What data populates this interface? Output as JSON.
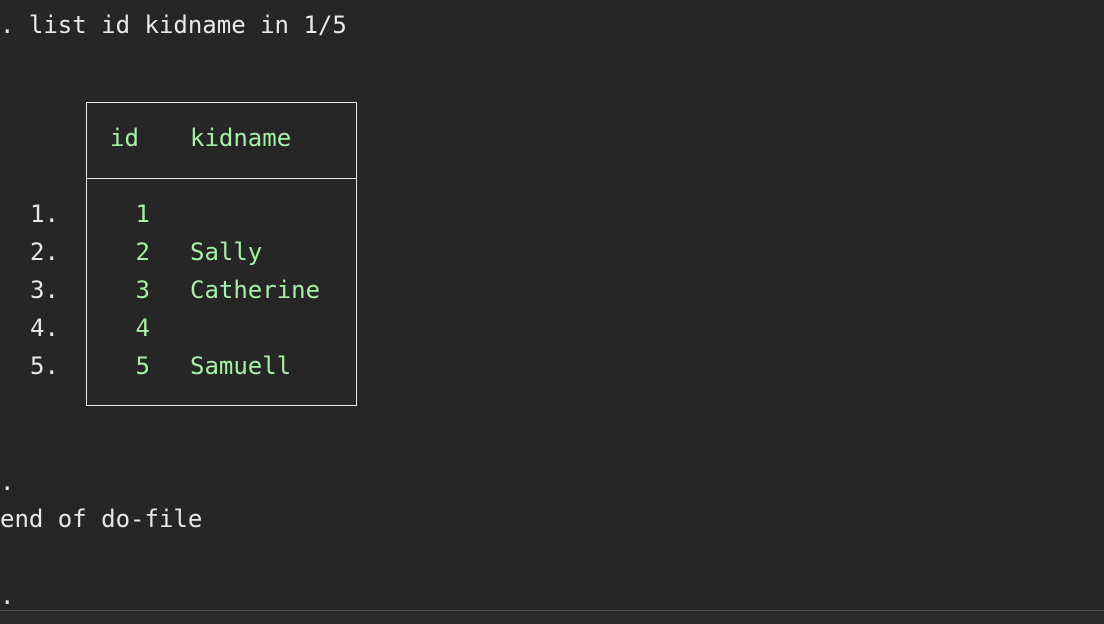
{
  "command": {
    "prompt": ".",
    "text": "list id kidname in 1/5"
  },
  "table": {
    "headers": [
      "id",
      "kidname"
    ],
    "rows": [
      {
        "num": "1.",
        "id": "1",
        "kidname": ""
      },
      {
        "num": "2.",
        "id": "2",
        "kidname": "Sally"
      },
      {
        "num": "3.",
        "id": "3",
        "kidname": "Catherine"
      },
      {
        "num": "4.",
        "id": "4",
        "kidname": ""
      },
      {
        "num": "5.",
        "id": "5",
        "kidname": "Samuell"
      }
    ]
  },
  "after": {
    "prompt1": ".",
    "message": "end of do-file",
    "prompt2": "."
  },
  "colors": {
    "background": "#262626",
    "text": "#e8e8e8",
    "result": "#a6f0a6"
  }
}
